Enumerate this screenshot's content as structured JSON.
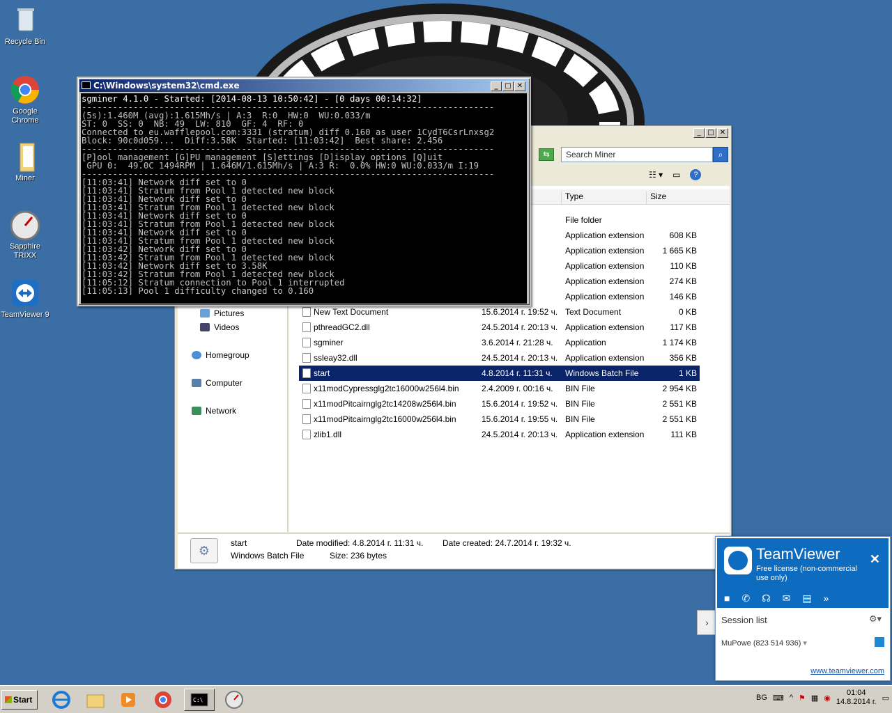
{
  "desktop": {
    "icons": [
      {
        "label": "Recycle Bin",
        "icon": "recycle-bin-icon"
      },
      {
        "label": "Google Chrome",
        "icon": "chrome-icon"
      },
      {
        "label": "Miner",
        "icon": "folder-icon"
      },
      {
        "label": "Sapphire TRIXX",
        "icon": "gauge-icon"
      },
      {
        "label": "TeamViewer 9",
        "icon": "teamviewer-icon"
      }
    ]
  },
  "cmd": {
    "title": "C:\\Windows\\system32\\cmd.exe",
    "header": "sgminer 4.1.0 - Started: [2014-08-13 10:50:42] - [0 days 00:14:32]",
    "sep": "--------------------------------------------------------------------------------",
    "stats": [
      "(5s):1.460M (avg):1.615Mh/s | A:3  R:0  HW:0  WU:0.033/m",
      "ST: 0  SS: 0  NB: 49  LW: 810  GF: 4  RF: 0",
      "Connected to eu.wafflepool.com:3331 (stratum) diff 0.160 as user 1CydT6CsrLnxsg2",
      "Block: 90c0d059...  Diff:3.58K  Started: [11:03:42]  Best share: 2.456"
    ],
    "menu": "[P]ool management [G]PU management [S]ettings [D]isplay options [Q]uit",
    "gpu": " GPU 0:  49.0C 1494RPM | 1.646M/1.615Mh/s | A:3 R:  0.0% HW:0 WU:0.033/m I:19",
    "log": [
      "[11:03:41] Network diff set to 0",
      "[11:03:41] Stratum from Pool 1 detected new block",
      "[11:03:41] Network diff set to 0",
      "[11:03:41] Stratum from Pool 1 detected new block",
      "[11:03:41] Network diff set to 0",
      "[11:03:41] Stratum from Pool 1 detected new block",
      "[11:03:41] Network diff set to 0",
      "[11:03:41] Stratum from Pool 1 detected new block",
      "[11:03:42] Network diff set to 0",
      "[11:03:42] Stratum from Pool 1 detected new block",
      "[11:03:42] Network diff set to 3.58K",
      "[11:03:42] Stratum from Pool 1 detected new block",
      "[11:05:12] Stratum connection to Pool 1 interrupted",
      "[11:05:13] Pool 1 difficulty changed to 0.160"
    ]
  },
  "explorer": {
    "search_placeholder": "Search Miner",
    "columns": {
      "type": "Type",
      "size": "Size"
    },
    "nav": [
      "Pictures",
      "Videos",
      "Homegroup",
      "Computer",
      "Network"
    ],
    "rows": [
      {
        "name": "",
        "date": "0:14 ч.",
        "type": "File folder",
        "size": ""
      },
      {
        "name": "",
        "date": "0:13 ч.",
        "type": "Application extension",
        "size": "608 KB"
      },
      {
        "name": "",
        "date": "0:13 ч.",
        "type": "Application extension",
        "size": "1 665 KB"
      },
      {
        "name": "",
        "date": "0:13 ч.",
        "type": "Application extension",
        "size": "110 KB"
      },
      {
        "name": "",
        "date": "0:13 ч.",
        "type": "Application extension",
        "size": "274 KB"
      },
      {
        "name": "",
        "date": "0:13 ч.",
        "type": "Application extension",
        "size": "146 KB"
      },
      {
        "name": "New Text Document",
        "date": "15.6.2014 г. 19:52 ч.",
        "type": "Text Document",
        "size": "0 KB"
      },
      {
        "name": "pthreadGC2.dll",
        "date": "24.5.2014 г. 20:13 ч.",
        "type": "Application extension",
        "size": "117 KB"
      },
      {
        "name": "sgminer",
        "date": "3.6.2014 г. 21:28 ч.",
        "type": "Application",
        "size": "1 174 KB"
      },
      {
        "name": "ssleay32.dll",
        "date": "24.5.2014 г. 20:13 ч.",
        "type": "Application extension",
        "size": "356 KB"
      },
      {
        "name": "start",
        "date": "4.8.2014 г. 11:31 ч.",
        "type": "Windows Batch File",
        "size": "1 KB"
      },
      {
        "name": "x11modCypressglg2tc16000w256l4.bin",
        "date": "2.4.2009 г. 00:16 ч.",
        "type": "BIN File",
        "size": "2 954 KB"
      },
      {
        "name": "x11modPitcairnglg2tc14208w256l4.bin",
        "date": "15.6.2014 г. 19:52 ч.",
        "type": "BIN File",
        "size": "2 551 KB"
      },
      {
        "name": "x11modPitcairnglg2tc16000w256l4.bin",
        "date": "15.6.2014 г. 19:55 ч.",
        "type": "BIN File",
        "size": "2 551 KB"
      },
      {
        "name": "zlib1.dll",
        "date": "24.5.2014 г. 20:13 ч.",
        "type": "Application extension",
        "size": "111 KB"
      }
    ],
    "details": {
      "name": "start",
      "kind": "Windows Batch File",
      "modified": "Date modified: 4.8.2014 г. 11:31 ч.",
      "created": "Date created: 24.7.2014 г. 19:32 ч.",
      "size": "Size: 236 bytes"
    }
  },
  "teamviewer": {
    "title": "TeamViewer",
    "subtitle": "Free license (non-commercial use only)",
    "session_list": "Session list",
    "partner": "MuPowe (823 514 936)",
    "link": "www.teamviewer.com"
  },
  "taskbar": {
    "start": "Start",
    "lang": "BG",
    "time": "01:04",
    "date": "14.8.2014 г."
  }
}
